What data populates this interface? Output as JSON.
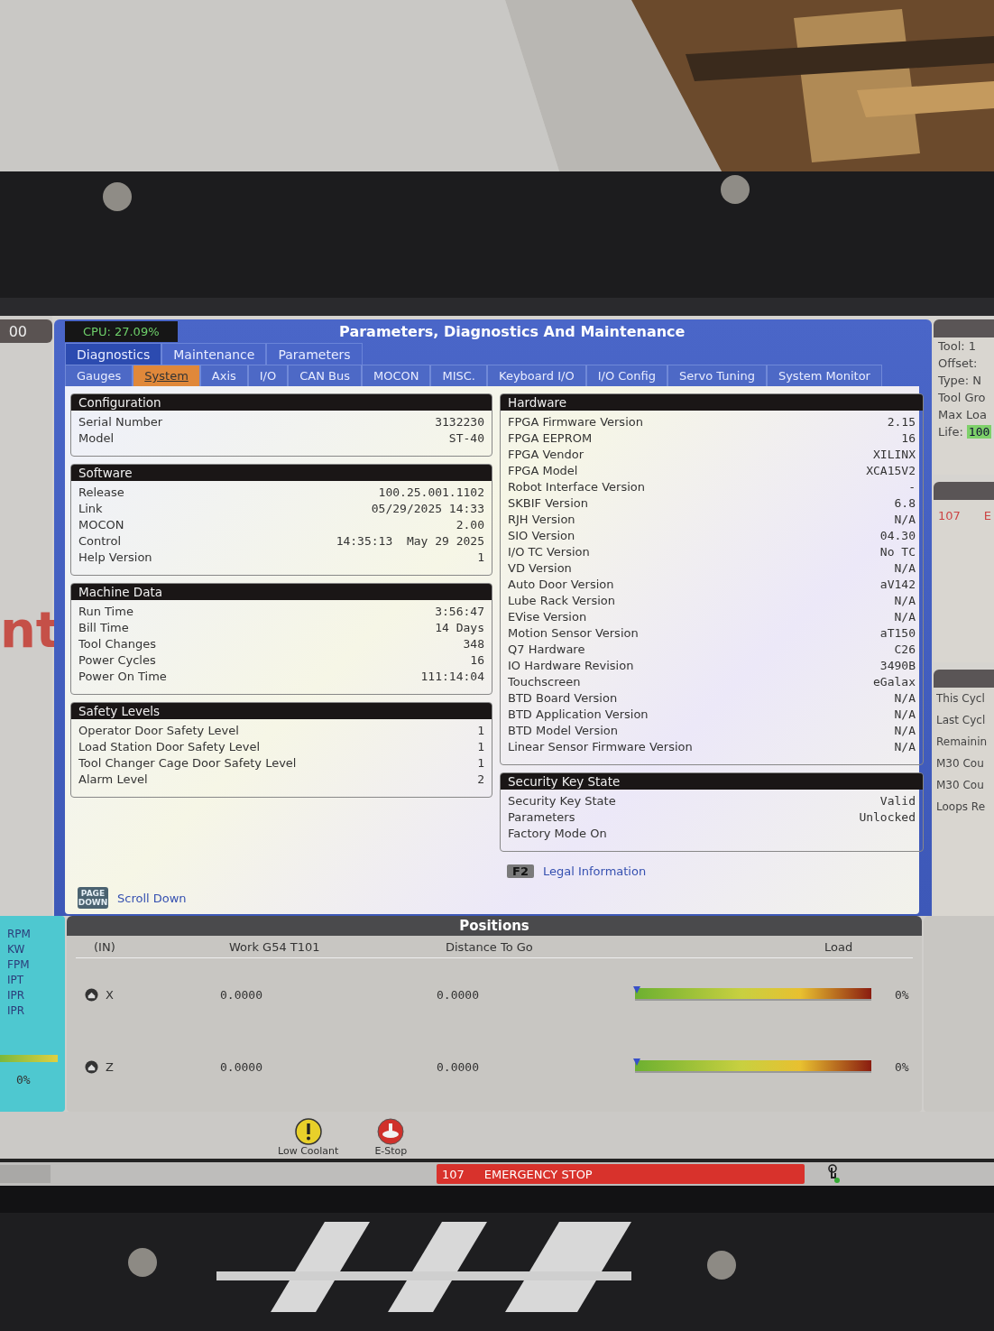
{
  "left_strip": {
    "header": "00",
    "big_text": "nt",
    "units": [
      "RPM",
      "KW",
      "FPM",
      "IPT",
      "IPR",
      "IPR"
    ],
    "reading": "0%"
  },
  "window": {
    "cpu": "CPU: 27.09%",
    "title": "Parameters, Diagnostics And Maintenance"
  },
  "tabs": [
    {
      "label": "Diagnostics",
      "selected": true
    },
    {
      "label": "Maintenance",
      "selected": false
    },
    {
      "label": "Parameters",
      "selected": false
    }
  ],
  "subtabs": [
    {
      "label": "Gauges",
      "selected": false
    },
    {
      "label": "System",
      "selected": true
    },
    {
      "label": "Axis",
      "selected": false
    },
    {
      "label": "I/O",
      "selected": false
    },
    {
      "label": "CAN Bus",
      "selected": false
    },
    {
      "label": "MOCON",
      "selected": false
    },
    {
      "label": "MISC.",
      "selected": false
    },
    {
      "label": "Keyboard I/O",
      "selected": false
    },
    {
      "label": "I/O Config",
      "selected": false
    },
    {
      "label": "Servo Tuning",
      "selected": false
    },
    {
      "label": "System Monitor",
      "selected": false
    }
  ],
  "left_sections": [
    {
      "title": "Configuration",
      "rows": [
        {
          "label": "Serial Number",
          "value": "3132230"
        },
        {
          "label": "Model",
          "value": "ST-40"
        }
      ]
    },
    {
      "title": "Software",
      "rows": [
        {
          "label": "Release",
          "value": "100.25.001.1102"
        },
        {
          "label": "Link",
          "value": "05/29/2025 14:33"
        },
        {
          "label": "MOCON",
          "value": "2.00"
        },
        {
          "label": "Control",
          "value": "14:35:13  May 29 2025"
        },
        {
          "label": "Help Version",
          "value": "1"
        }
      ]
    },
    {
      "title": "Machine Data",
      "rows": [
        {
          "label": "Run Time",
          "value": "3:56:47"
        },
        {
          "label": "Bill Time",
          "value": "14 Days"
        },
        {
          "label": "Tool Changes",
          "value": "348"
        },
        {
          "label": "Power Cycles",
          "value": "16"
        },
        {
          "label": "Power On Time",
          "value": "111:14:04"
        }
      ]
    },
    {
      "title": "Safety Levels",
      "rows": [
        {
          "label": "Operator Door Safety Level",
          "value": "1"
        },
        {
          "label": "Load Station Door Safety Level",
          "value": "1"
        },
        {
          "label": "Tool Changer Cage Door Safety Level",
          "value": "1"
        },
        {
          "label": "Alarm Level",
          "value": "2"
        }
      ]
    }
  ],
  "right_sections": [
    {
      "title": "Hardware",
      "rows": [
        {
          "label": "FPGA Firmware Version",
          "value": "2.15"
        },
        {
          "label": "FPGA EEPROM",
          "value": "16"
        },
        {
          "label": "FPGA Vendor",
          "value": "XILINX"
        },
        {
          "label": "FPGA Model",
          "value": "XCA15V2"
        },
        {
          "label": "Robot Interface Version",
          "value": "-"
        },
        {
          "label": "SKBIF Version",
          "value": "6.8"
        },
        {
          "label": "RJH Version",
          "value": "N/A"
        },
        {
          "label": "SIO Version",
          "value": "04.30"
        },
        {
          "label": "I/O TC Version",
          "value": "No TC"
        },
        {
          "label": "VD Version",
          "value": "N/A"
        },
        {
          "label": "Auto Door Version",
          "value": "aV142"
        },
        {
          "label": "Lube Rack Version",
          "value": "N/A"
        },
        {
          "label": "EVise Version",
          "value": "N/A"
        },
        {
          "label": "Motion Sensor Version",
          "value": "aT150"
        },
        {
          "label": "Q7 Hardware",
          "value": "C26"
        },
        {
          "label": "IO Hardware Revision",
          "value": "3490B"
        },
        {
          "label": "Touchscreen",
          "value": "eGalax"
        },
        {
          "label": "BTD Board Version",
          "value": "N/A"
        },
        {
          "label": "BTD Application Version",
          "value": "N/A"
        },
        {
          "label": "BTD Model Version",
          "value": "N/A"
        },
        {
          "label": "Linear Sensor Firmware Version",
          "value": "N/A"
        }
      ]
    },
    {
      "title": "Security Key State",
      "rows": [
        {
          "label": "Security Key State",
          "value": "Valid"
        },
        {
          "label": "Parameters",
          "value": "Unlocked"
        },
        {
          "label": "Factory Mode On"
        }
      ]
    }
  ],
  "scroll_hint": {
    "key": "PAGE DOWN",
    "label": "Scroll Down"
  },
  "legal": {
    "key": "F2",
    "label": "Legal Information"
  },
  "tool_panel": {
    "lines": [
      "Tool: 1",
      "Offset:",
      "Type: N",
      "Tool Gro",
      "Max Loa"
    ],
    "life_label": "Life:",
    "life_value": "100"
  },
  "alarm_panel": {
    "code": "107",
    "text": "E"
  },
  "counters": [
    "This Cycl",
    "Last Cycl",
    "Remainin",
    "M30 Cou",
    "M30 Cou",
    "Loops Re"
  ],
  "positions": {
    "title": "Positions",
    "columns": [
      "(IN)",
      "Work G54 T101",
      "Distance To Go",
      "Load"
    ],
    "rows": [
      {
        "axis": "X",
        "work": "0.0000",
        "distance": "0.0000",
        "level": 0,
        "load": "0%"
      },
      {
        "axis": "Z",
        "work": "0.0000",
        "distance": "0.0000",
        "level": 0,
        "load": "0%"
      }
    ]
  },
  "alerts": [
    {
      "kind": "warning",
      "label": "Low Coolant"
    },
    {
      "kind": "estop",
      "label": "E-Stop"
    }
  ],
  "status": {
    "code": "107",
    "message": "EMERGENCY STOP"
  }
}
